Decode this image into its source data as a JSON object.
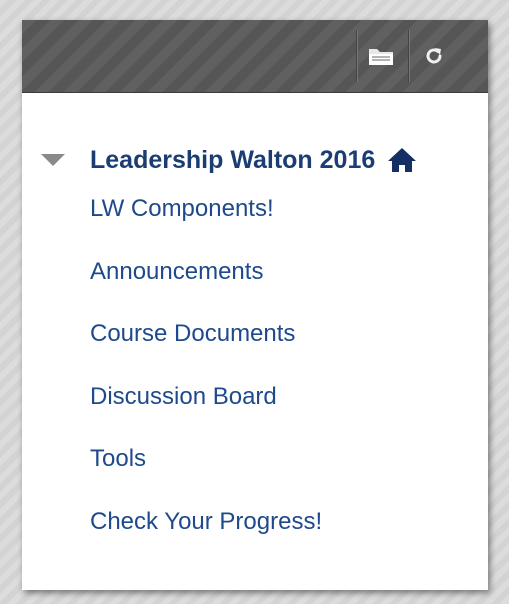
{
  "toolbar": {
    "folder_button": "folder-icon",
    "refresh_button": "refresh-icon"
  },
  "course": {
    "title": "Leadership Walton 2016",
    "expanded": true,
    "home_icon": "home-icon"
  },
  "menu": {
    "items": [
      {
        "label": "LW Components!"
      },
      {
        "label": "Announcements"
      },
      {
        "label": "Course Documents"
      },
      {
        "label": "Discussion Board"
      },
      {
        "label": "Tools"
      },
      {
        "label": "Check Your Progress!"
      }
    ]
  },
  "colors": {
    "title": "#1b3d73",
    "link": "#1e4a8c",
    "toolbar": "#5a5a5a"
  }
}
